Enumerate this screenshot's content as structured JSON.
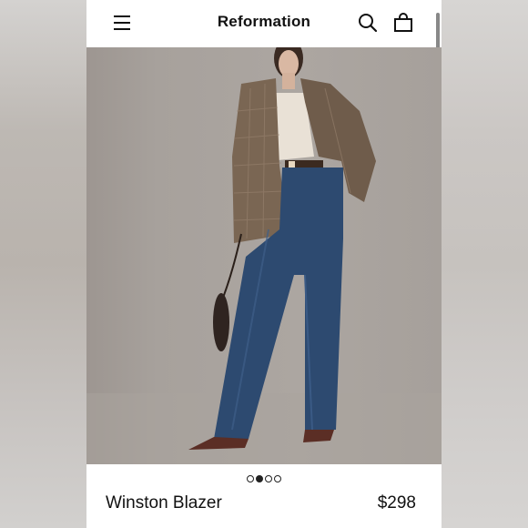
{
  "header": {
    "brand": "Reformation",
    "icons": [
      "menu-icon",
      "search-icon",
      "shopping-bag-icon"
    ]
  },
  "gallery": {
    "image_count": 4,
    "active_index": 2
  },
  "product": {
    "name": "Winston Blazer",
    "price": "$298"
  },
  "colors": {
    "background": "#ffffff",
    "text": "#111111",
    "photo_backdrop": "#aaa49f"
  }
}
